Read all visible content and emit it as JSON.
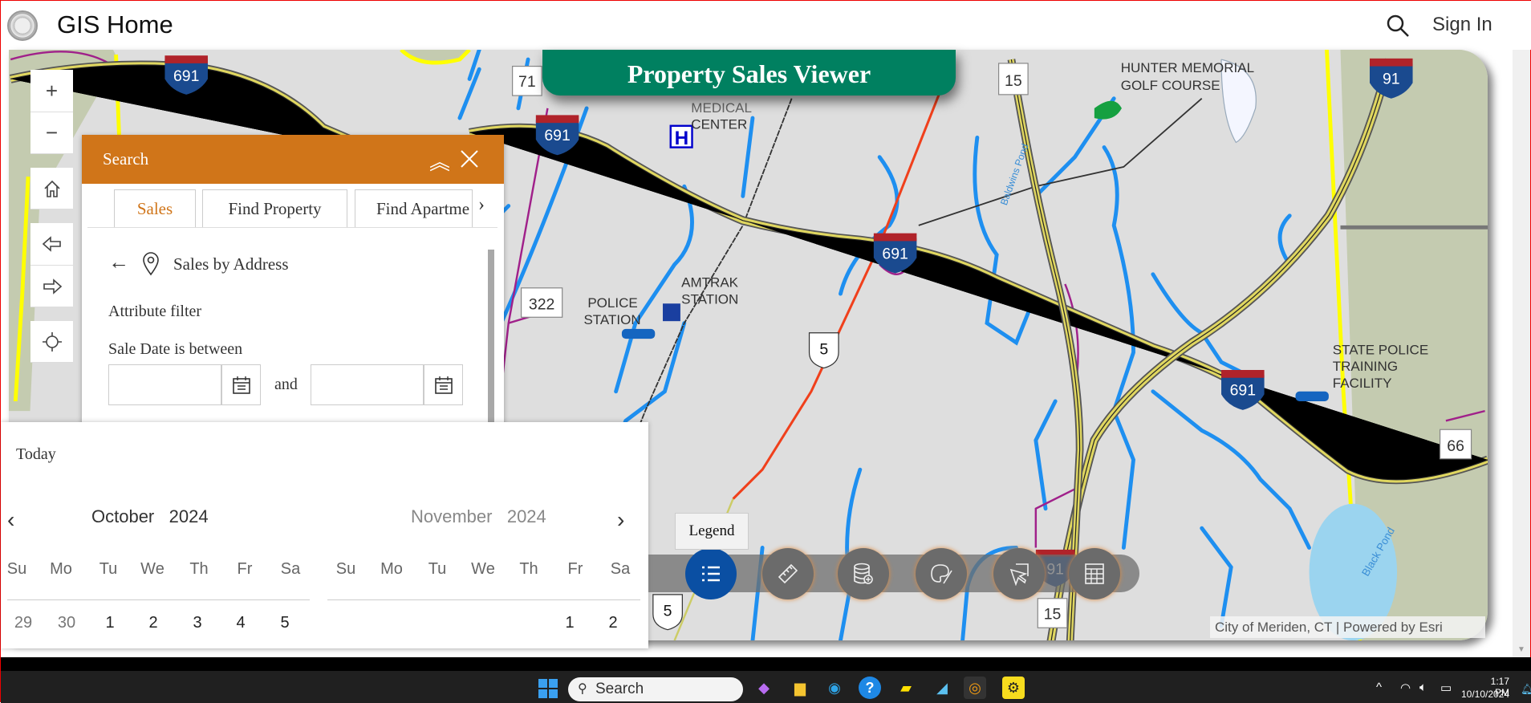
{
  "header": {
    "title": "GIS Home",
    "sign_in": "Sign In",
    "logo_text": "City of Meriden seal"
  },
  "banner": {
    "title": "Property Sales Viewer"
  },
  "map": {
    "labels": {
      "golf1": "HUNTER MEMORIAL",
      "golf2": "GOLF COURSE",
      "med1": "MEDICAL",
      "med2": "CENTER",
      "amtrak1": "AMTRAK",
      "amtrak2": "STATION",
      "police1": "POLICE",
      "police2": "STATION",
      "sp1": "STATE POLICE",
      "sp2": "TRAINING",
      "sp3": "FACILITY",
      "pond": "Black Pond",
      "pond2": "Baldwins Pond"
    },
    "shields": {
      "i691": "691",
      "i91": "91",
      "r71": "71",
      "r15": "15",
      "r322": "322",
      "r66": "66",
      "us5": "5"
    },
    "attribution": "City of Meriden, CT | Powered by Esri"
  },
  "search_panel": {
    "title": "Search",
    "tabs": [
      {
        "label": "Sales",
        "active": true
      },
      {
        "label": "Find Property"
      },
      {
        "label": "Find Apartme"
      }
    ],
    "section": "Sales by Address",
    "filter_label": "Attribute filter",
    "date_label": "Sale Date is between",
    "start_date": "",
    "end_date": "",
    "and": "and"
  },
  "calendar": {
    "today": "Today",
    "left": {
      "month": "October",
      "year": "2024",
      "days": [
        "29",
        "30",
        "1",
        "2",
        "3",
        "4",
        "5"
      ]
    },
    "right": {
      "month": "November",
      "year": "2024",
      "days": [
        "1",
        "2"
      ]
    },
    "weekdays": [
      "Su",
      "Mo",
      "Tu",
      "We",
      "Th",
      "Fr",
      "Sa"
    ]
  },
  "toolbar": {
    "tooltip": "Legend",
    "buttons": [
      "Legend",
      "Measure",
      "Add Data",
      "Draw",
      "Select",
      "Attribute Table"
    ],
    "active_color": "#0a4fa3"
  },
  "taskbar": {
    "search": "Search",
    "time": "1:17 PM",
    "date": "10/10/2024"
  },
  "colors": {
    "header_orange": "#d07519",
    "banner_green": "#008060"
  }
}
